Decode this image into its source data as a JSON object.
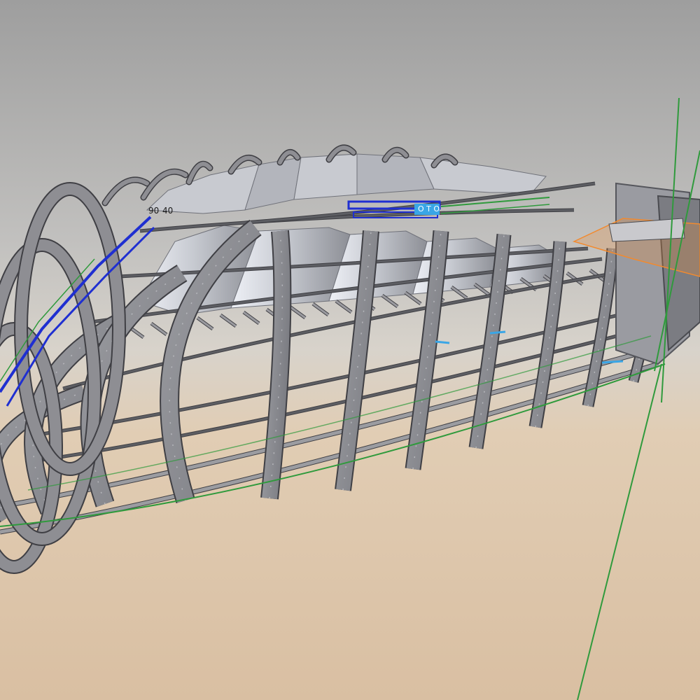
{
  "viewport": {
    "background_top": "#a4a4a4",
    "background_mid": "#d3d0cb",
    "floor_near": "#e6cdb0",
    "floor_far": "#d8bfa1"
  },
  "colors": {
    "frame_fill": "#8e8e93",
    "frame_edge": "#3f3f44",
    "frame_fill_dark": "#6f7077",
    "skin_light": "#e9ebf1",
    "skin_mid": "#b9bcc4",
    "skin_dark": "#8a8c94",
    "stringer": "#5d5e63",
    "selection_blue": "#1f2fd1",
    "highlight_cyan": "#3aa6e6",
    "axis_green": "#2f9a3c",
    "selected_box": "#f28a2e"
  },
  "view_labels": {
    "small_labels": [
      "90",
      "40"
    ],
    "tag_text": "O T O"
  },
  "scene_parts": {
    "frames": "fuselage-frame",
    "stringers": "longitudinal-stringer",
    "skin": "upper-skin-panel",
    "axis": "reference-axis",
    "box": "selected-bounding-box"
  }
}
